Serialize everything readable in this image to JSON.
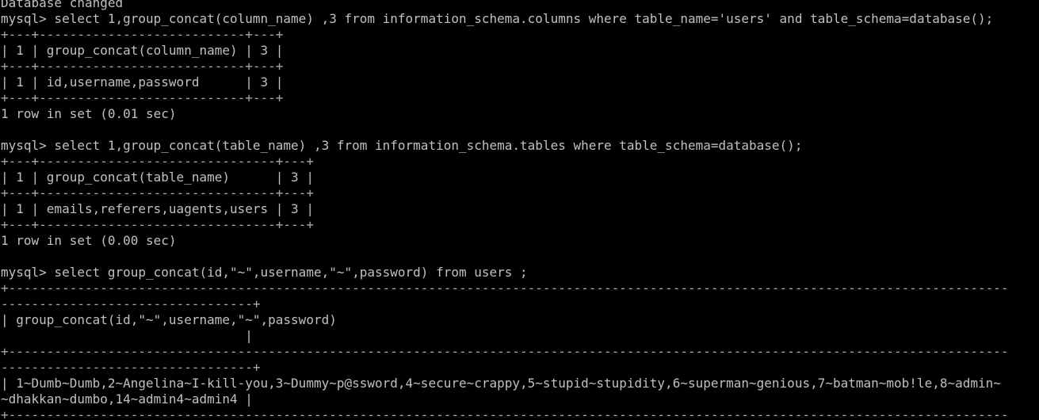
{
  "terminal": {
    "lines": [
      "Database changed",
      "mysql> select 1,group_concat(column_name) ,3 from information_schema.columns where table_name='users' and table_schema=database();",
      "+---+---------------------------+---+",
      "| 1 | group_concat(column_name) | 3 |",
      "+---+---------------------------+---+",
      "| 1 | id,username,password      | 3 |",
      "+---+---------------------------+---+",
      "1 row in set (0.01 sec)",
      "",
      "mysql> select 1,group_concat(table_name) ,3 from information_schema.tables where table_schema=database();",
      "+---+-------------------------------+---+",
      "| 1 | group_concat(table_name)      | 3 |",
      "+---+-------------------------------+---+",
      "| 1 | emails,referers,uagents,users | 3 |",
      "+---+-------------------------------+---+",
      "1 row in set (0.00 sec)",
      "",
      "mysql> select group_concat(id,\"~\",username,\"~\",password) from users ;",
      "+-----------------------------------------------------------------------------------------------------------------------------------",
      "---------------------------------+",
      "| group_concat(id,\"~\",username,\"~\",password)",
      "                                |",
      "+-----------------------------------------------------------------------------------------------------------------------------------",
      "---------------------------------+",
      "| 1~Dumb~Dumb,2~Angelina~I-kill-you,3~Dummy~p@ssword,4~secure~crappy,5~stupid~stupidity,6~superman~genious,7~batman~mob!le,8~admin~",
      "~dhakkan~dumbo,14~admin4~admin4 |",
      "+-----------------------------------------------------------------------------------------------------------------------------------",
      "---------------------------------+"
    ]
  }
}
